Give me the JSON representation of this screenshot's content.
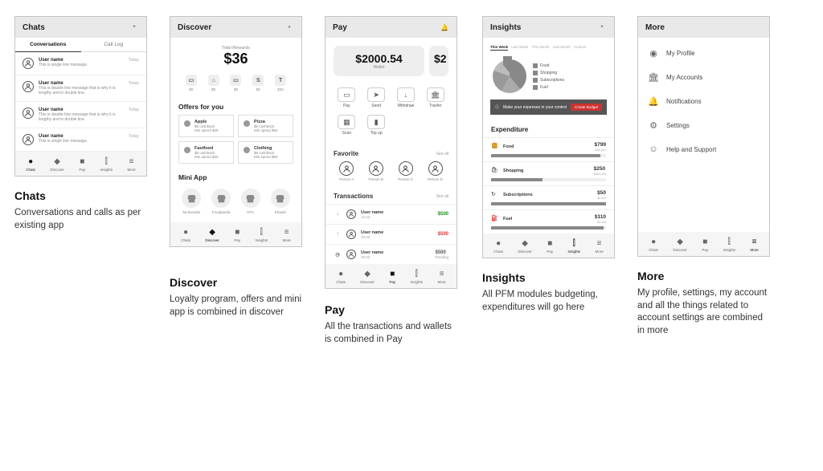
{
  "nav": {
    "chats": "Chats",
    "discover": "Discover",
    "pay": "Pay",
    "insights": "Insights",
    "more": "More"
  },
  "chats": {
    "title": "Chats",
    "tabs": {
      "conv": "Conversations",
      "call": "Call Log"
    },
    "rows": [
      {
        "name": "User name",
        "msg": "This is single line message.",
        "time": "Today"
      },
      {
        "name": "User name",
        "msg": "This is double line message that is why it is lengthy and in double line.",
        "time": "Today"
      },
      {
        "name": "User name",
        "msg": "This is double line message that is why it is lengthy and in double line.",
        "time": "Today"
      },
      {
        "name": "User name",
        "msg": "This is single line message.",
        "time": "Today"
      }
    ]
  },
  "discover": {
    "title": "Discover",
    "rewards": {
      "label": "Total Rewards",
      "amount": "$36"
    },
    "cats": [
      {
        "l": "$0"
      },
      {
        "l": "$0"
      },
      {
        "l": "$0"
      },
      {
        "l": "$0"
      },
      {
        "l": "$35"
      }
    ],
    "offersTitle": "Offers for you",
    "offers": [
      {
        "n": "Apple",
        "c": "$5 cashback",
        "m": "Min spend $30"
      },
      {
        "n": "Pizza",
        "c": "$5 cashback",
        "m": "Min spend $50"
      },
      {
        "n": "Fastfood",
        "c": "$5 cashback",
        "m": "Min spend $30"
      },
      {
        "n": "Clothing",
        "c": "$5 cashback",
        "m": "Min spend $50"
      }
    ],
    "miniTitle": "Mini App",
    "minis": [
      "Mcdonalds",
      "Foodpanda",
      "KFC",
      "Khaadi"
    ]
  },
  "pay": {
    "title": "Pay",
    "wallet": {
      "amount": "$2000.54",
      "label": "Wallet",
      "partial": "$2"
    },
    "actions": [
      "Pay",
      "Send",
      "Withdraw",
      "Trasfer",
      "Scan",
      "Top up"
    ],
    "favTitle": "Favorite",
    "seeAll": "See all",
    "favs": [
      "Person A",
      "Person B",
      "Person C",
      "Person D"
    ],
    "txTitle": "Transactions",
    "txs": [
      {
        "dir": "in",
        "name": "User name",
        "time": "14:42",
        "amt": "$500",
        "status": "",
        "color": "#1a8f1a"
      },
      {
        "dir": "out",
        "name": "User name",
        "time": "10:42",
        "amt": "$500",
        "status": "",
        "color": "#d33"
      },
      {
        "dir": "pending",
        "name": "User name",
        "time": "10:42",
        "amt": "$500",
        "status": "Pending",
        "color": "#555"
      }
    ]
  },
  "insights": {
    "title": "Insights",
    "chips": [
      "This Week",
      "Last Week",
      "This Month",
      "Last Month",
      "Custom"
    ],
    "legend": [
      "Food",
      "Shopping",
      "Subscriptions",
      "Fuel"
    ],
    "banner": {
      "text": "Make your expenses in your control",
      "btn": "Create Budget"
    },
    "expTitle": "Expenditure",
    "exp": [
      {
        "n": "Food",
        "a": "$799",
        "s": "$43 per",
        "p": 95
      },
      {
        "n": "Shopping",
        "a": "$250",
        "s": "$565 left",
        "p": 45
      },
      {
        "n": "Subscriptions",
        "a": "$50",
        "s": "$0 left",
        "p": 100
      },
      {
        "n": "Fuel",
        "a": "$110",
        "s": "$0 left",
        "p": 98
      }
    ]
  },
  "more": {
    "title": "More",
    "items": [
      "My Profile",
      "My Accounts",
      "Notifications",
      "Settings",
      "Help and Support"
    ]
  },
  "captions": {
    "chats": {
      "t": "Chats",
      "d": "Conversations and calls as per existing app"
    },
    "discover": {
      "t": "Discover",
      "d": "Loyalty program, offers and mini app is combined in discover"
    },
    "pay": {
      "t": "Pay",
      "d": "All the transactions and wallets is combined in Pay"
    },
    "insights": {
      "t": "Insights",
      "d": "All PFM modules budgeting, expenditures will go here"
    },
    "more": {
      "t": "More",
      "d": "My profile, settings, my account and all the things related to account settings are combined in more"
    }
  },
  "glyph": {
    "plus": "+",
    "search": "⌕",
    "bell": "🔔",
    "menu": "≡",
    "dollar": "$",
    "t": "T",
    "s": "S",
    "card": "▭",
    "send": "➤",
    "down": "↓",
    "bank": "🏛",
    "qr": "▦",
    "phone": "▮",
    "arrDown": "↓",
    "arrUp": "↑",
    "clock": "◷",
    "store": "⌂",
    "user": "◯",
    "tag": "◆",
    "wallet": "■",
    "chart": "⫿",
    "food": "🍔",
    "shop": "🛍",
    "sub": "↻",
    "fuel": "⛽",
    "info": "ⓘ",
    "profile": "◉",
    "accounts": "🏛",
    "notif": "🔔",
    "gear": "⚙",
    "help": "☺"
  }
}
